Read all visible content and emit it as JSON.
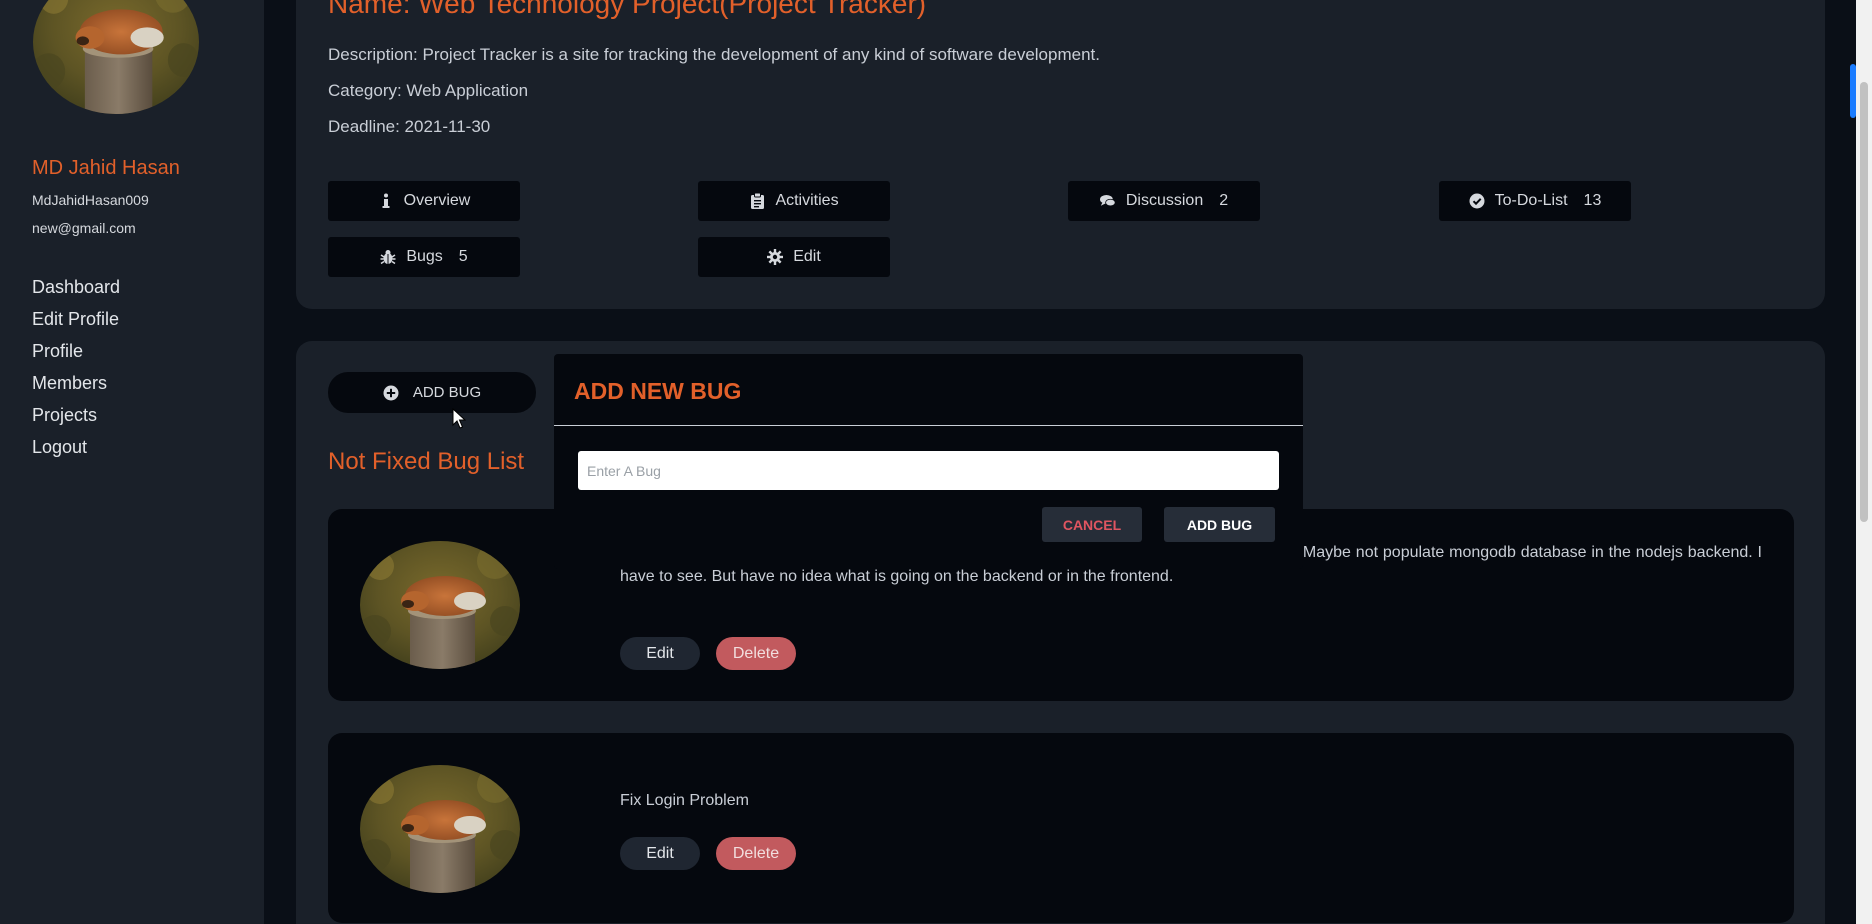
{
  "user": {
    "name": "MD Jahid Hasan",
    "handle": "MdJahidHasan009",
    "email": "new@gmail.com"
  },
  "nav": [
    {
      "label": "Dashboard"
    },
    {
      "label": "Edit Profile"
    },
    {
      "label": "Profile"
    },
    {
      "label": "Members"
    },
    {
      "label": "Projects"
    },
    {
      "label": "Logout"
    }
  ],
  "project": {
    "name": "Name: Web Technology Project(Project Tracker)",
    "description": "Description: Project Tracker is a site for tracking the development of any kind of software development.",
    "category": "Category: Web Application",
    "deadline": "Deadline: 2021-11-30"
  },
  "tabs": {
    "overview": {
      "label": "Overview",
      "icon": "info-icon"
    },
    "activities": {
      "label": "Activities",
      "icon": "clipboard-icon"
    },
    "discussion": {
      "label": "Discussion",
      "count": "2",
      "icon": "comments-icon"
    },
    "todo": {
      "label": "To-Do-List",
      "count": "13",
      "icon": "check-circle-icon"
    },
    "bugs": {
      "label": "Bugs",
      "count": "5",
      "icon": "bug-icon"
    },
    "edit": {
      "label": "Edit",
      "icon": "gear-icon"
    }
  },
  "bug_section": {
    "add_label": "ADD BUG",
    "title": "Not Fixed Bug List",
    "bugs": [
      {
        "text": "show no member found=>default one). But after refreshing the correct member image appears. Maybe not populate mongodb database in the nodejs backend. I have to see. But have no idea what is going on the backend or in the frontend.",
        "edit_label": "Edit",
        "delete_label": "Delete"
      },
      {
        "text": "Fix Login Problem",
        "edit_label": "Edit",
        "delete_label": "Delete"
      }
    ]
  },
  "modal": {
    "title": "ADD NEW BUG",
    "input_placeholder": "Enter A Bug",
    "input_value": "",
    "cancel_label": "CANCEL",
    "add_label": "ADD BUG"
  },
  "colors": {
    "accent": "#e2602a",
    "background": "#0a0f17",
    "panel": "#1a2029",
    "dark": "#05080e",
    "delete": "#c25a5e",
    "cancel_text": "#e05561"
  }
}
